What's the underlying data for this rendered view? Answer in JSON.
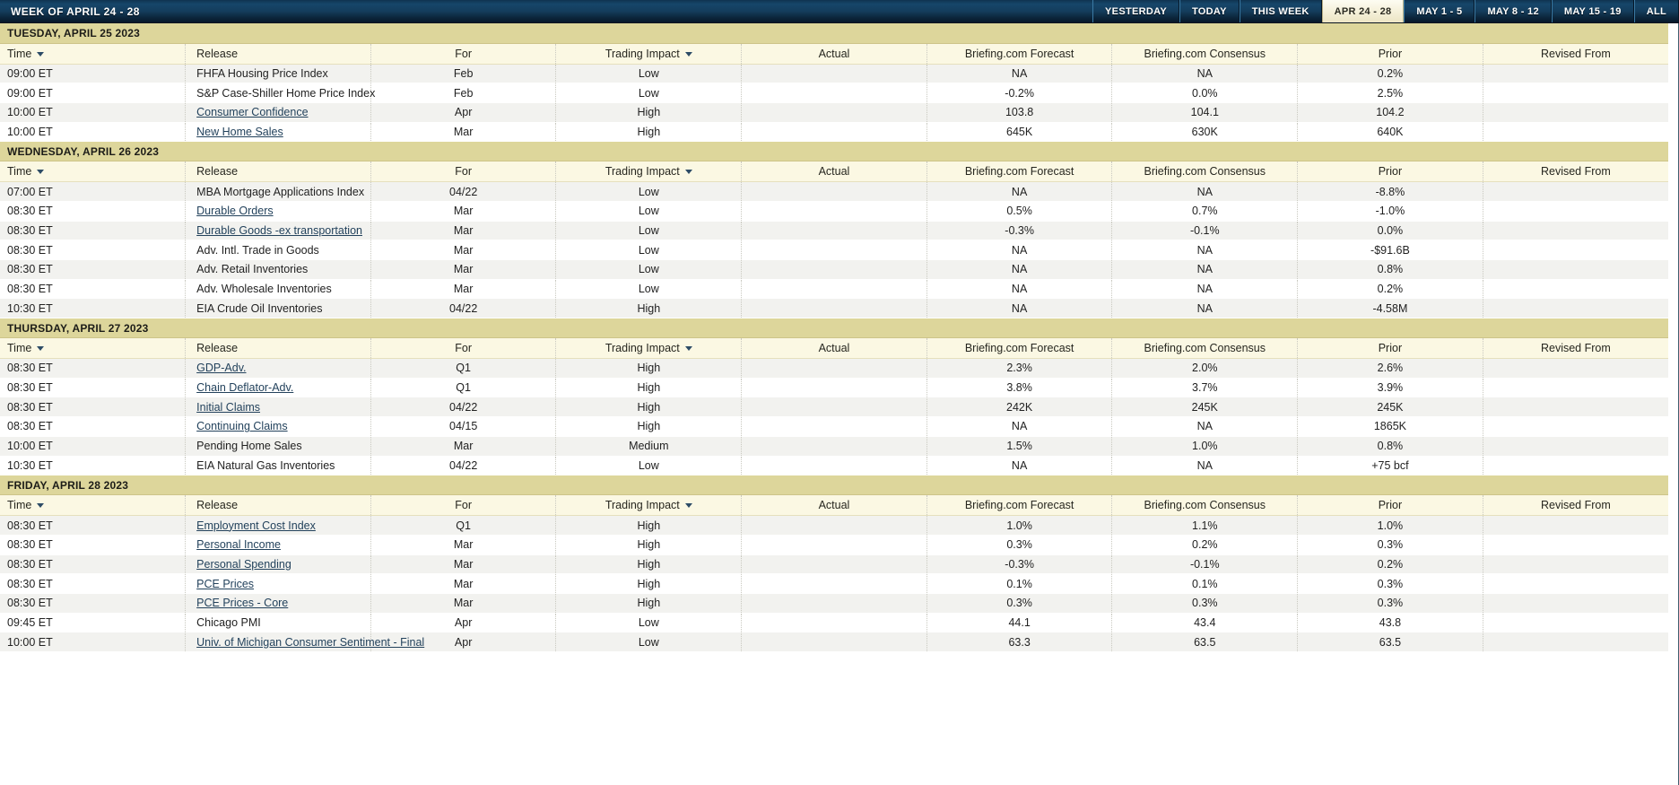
{
  "header": {
    "title": "WEEK OF APRIL 24 - 28",
    "nav_buttons": [
      {
        "label": "YESTERDAY",
        "active": false
      },
      {
        "label": "TODAY",
        "active": false
      },
      {
        "label": "THIS WEEK",
        "active": false
      },
      {
        "label": "APR 24 - 28",
        "active": true
      },
      {
        "label": "MAY 1 - 5",
        "active": false
      },
      {
        "label": "MAY 8 - 12",
        "active": false
      },
      {
        "label": "MAY 15 - 19",
        "active": false
      },
      {
        "label": "ALL",
        "active": false
      }
    ]
  },
  "columns": {
    "time": "Time",
    "release": "Release",
    "for": "For",
    "trading_impact": "Trading Impact",
    "actual": "Actual",
    "forecast": "Briefing.com Forecast",
    "consensus": "Briefing.com Consensus",
    "prior": "Prior",
    "revised_from": "Revised From"
  },
  "colors": {
    "day_header_bg": "#ddd69b",
    "column_header_bg": "#fbf8e3",
    "row_odd_bg": "#f2f2ef",
    "row_even_bg": "#ffffff",
    "topbar_bg": "#14405f",
    "link": "#23425c"
  },
  "days": [
    {
      "title": "TUESDAY, APRIL 25 2023",
      "rows": [
        {
          "time": "09:00 ET",
          "release": "FHFA Housing Price Index",
          "link": false,
          "for": "Feb",
          "impact": "Low",
          "actual": "",
          "forecast": "NA",
          "consensus": "NA",
          "prior": "0.2%",
          "revised_from": ""
        },
        {
          "time": "09:00 ET",
          "release": "S&P Case-Shiller Home Price Index",
          "link": false,
          "for": "Feb",
          "impact": "Low",
          "actual": "",
          "forecast": "-0.2%",
          "consensus": "0.0%",
          "prior": "2.5%",
          "revised_from": ""
        },
        {
          "time": "10:00 ET",
          "release": "Consumer Confidence",
          "link": true,
          "for": "Apr",
          "impact": "High",
          "actual": "",
          "forecast": "103.8",
          "consensus": "104.1",
          "prior": "104.2",
          "revised_from": ""
        },
        {
          "time": "10:00 ET",
          "release": "New Home Sales",
          "link": true,
          "for": "Mar",
          "impact": "High",
          "actual": "",
          "forecast": "645K",
          "consensus": "630K",
          "prior": "640K",
          "revised_from": ""
        }
      ]
    },
    {
      "title": "WEDNESDAY, APRIL 26 2023",
      "rows": [
        {
          "time": "07:00 ET",
          "release": "MBA Mortgage Applications Index",
          "link": false,
          "for": "04/22",
          "impact": "Low",
          "actual": "",
          "forecast": "NA",
          "consensus": "NA",
          "prior": "-8.8%",
          "revised_from": ""
        },
        {
          "time": "08:30 ET",
          "release": "Durable Orders",
          "link": true,
          "for": "Mar",
          "impact": "Low",
          "actual": "",
          "forecast": "0.5%",
          "consensus": "0.7%",
          "prior": "-1.0%",
          "revised_from": ""
        },
        {
          "time": "08:30 ET",
          "release": "Durable Goods -ex transportation",
          "link": true,
          "for": "Mar",
          "impact": "Low",
          "actual": "",
          "forecast": "-0.3%",
          "consensus": "-0.1%",
          "prior": "0.0%",
          "revised_from": ""
        },
        {
          "time": "08:30 ET",
          "release": "Adv. Intl. Trade in Goods",
          "link": false,
          "for": "Mar",
          "impact": "Low",
          "actual": "",
          "forecast": "NA",
          "consensus": "NA",
          "prior": "-$91.6B",
          "revised_from": ""
        },
        {
          "time": "08:30 ET",
          "release": "Adv. Retail Inventories",
          "link": false,
          "for": "Mar",
          "impact": "Low",
          "actual": "",
          "forecast": "NA",
          "consensus": "NA",
          "prior": "0.8%",
          "revised_from": ""
        },
        {
          "time": "08:30 ET",
          "release": "Adv. Wholesale Inventories",
          "link": false,
          "for": "Mar",
          "impact": "Low",
          "actual": "",
          "forecast": "NA",
          "consensus": "NA",
          "prior": "0.2%",
          "revised_from": ""
        },
        {
          "time": "10:30 ET",
          "release": "EIA Crude Oil Inventories",
          "link": false,
          "for": "04/22",
          "impact": "High",
          "actual": "",
          "forecast": "NA",
          "consensus": "NA",
          "prior": "-4.58M",
          "revised_from": ""
        }
      ]
    },
    {
      "title": "THURSDAY, APRIL 27 2023",
      "rows": [
        {
          "time": "08:30 ET",
          "release": "GDP-Adv.",
          "link": true,
          "for": "Q1",
          "impact": "High",
          "actual": "",
          "forecast": "2.3%",
          "consensus": "2.0%",
          "prior": "2.6%",
          "revised_from": ""
        },
        {
          "time": "08:30 ET",
          "release": "Chain Deflator-Adv.",
          "link": true,
          "for": "Q1",
          "impact": "High",
          "actual": "",
          "forecast": "3.8%",
          "consensus": "3.7%",
          "prior": "3.9%",
          "revised_from": ""
        },
        {
          "time": "08:30 ET",
          "release": "Initial Claims",
          "link": true,
          "for": "04/22",
          "impact": "High",
          "actual": "",
          "forecast": "242K",
          "consensus": "245K",
          "prior": "245K",
          "revised_from": ""
        },
        {
          "time": "08:30 ET",
          "release": "Continuing Claims",
          "link": true,
          "for": "04/15",
          "impact": "High",
          "actual": "",
          "forecast": "NA",
          "consensus": "NA",
          "prior": "1865K",
          "revised_from": ""
        },
        {
          "time": "10:00 ET",
          "release": "Pending Home Sales",
          "link": false,
          "for": "Mar",
          "impact": "Medium",
          "actual": "",
          "forecast": "1.5%",
          "consensus": "1.0%",
          "prior": "0.8%",
          "revised_from": ""
        },
        {
          "time": "10:30 ET",
          "release": "EIA Natural Gas Inventories",
          "link": false,
          "for": "04/22",
          "impact": "Low",
          "actual": "",
          "forecast": "NA",
          "consensus": "NA",
          "prior": "+75 bcf",
          "revised_from": ""
        }
      ]
    },
    {
      "title": "FRIDAY, APRIL 28 2023",
      "rows": [
        {
          "time": "08:30 ET",
          "release": "Employment Cost Index",
          "link": true,
          "for": "Q1",
          "impact": "High",
          "actual": "",
          "forecast": "1.0%",
          "consensus": "1.1%",
          "prior": "1.0%",
          "revised_from": ""
        },
        {
          "time": "08:30 ET",
          "release": "Personal Income",
          "link": true,
          "for": "Mar",
          "impact": "High",
          "actual": "",
          "forecast": "0.3%",
          "consensus": "0.2%",
          "prior": "0.3%",
          "revised_from": ""
        },
        {
          "time": "08:30 ET",
          "release": "Personal Spending",
          "link": true,
          "for": "Mar",
          "impact": "High",
          "actual": "",
          "forecast": "-0.3%",
          "consensus": "-0.1%",
          "prior": "0.2%",
          "revised_from": ""
        },
        {
          "time": "08:30 ET",
          "release": "PCE Prices",
          "link": true,
          "for": "Mar",
          "impact": "High",
          "actual": "",
          "forecast": "0.1%",
          "consensus": "0.1%",
          "prior": "0.3%",
          "revised_from": ""
        },
        {
          "time": "08:30 ET",
          "release": "PCE Prices - Core",
          "link": true,
          "for": "Mar",
          "impact": "High",
          "actual": "",
          "forecast": "0.3%",
          "consensus": "0.3%",
          "prior": "0.3%",
          "revised_from": ""
        },
        {
          "time": "09:45 ET",
          "release": "Chicago PMI",
          "link": false,
          "for": "Apr",
          "impact": "Low",
          "actual": "",
          "forecast": "44.1",
          "consensus": "43.4",
          "prior": "43.8",
          "revised_from": ""
        },
        {
          "time": "10:00 ET",
          "release": "Univ. of Michigan Consumer Sentiment - Final",
          "link": true,
          "for": "Apr",
          "impact": "Low",
          "actual": "",
          "forecast": "63.3",
          "consensus": "63.5",
          "prior": "63.5",
          "revised_from": ""
        }
      ]
    }
  ]
}
